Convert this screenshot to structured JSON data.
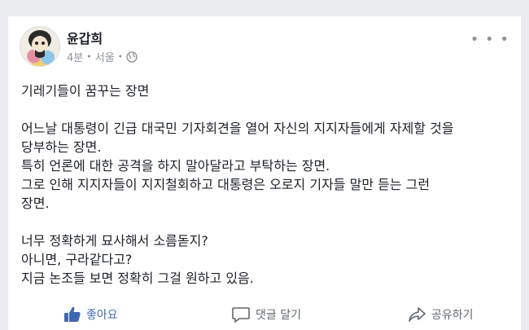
{
  "post": {
    "author": "윤갑희",
    "time": "4분",
    "location": "서울",
    "separator": "•",
    "title": "기레기들이 꿈꾸는 장면",
    "paragraph1": [
      "어느날 대통령이 긴급 대국민 기자회견을 열어 자신의 지지자들에게 자제할 것을",
      "당부하는 장면.",
      "특히 언론에 대한 공격을 하지 말아달라고 부탁하는 장면.",
      "그로 인해 지지자들이 지지철회하고 대통령은 오로지 기자들 말만 듣는 그런",
      "장면."
    ],
    "paragraph2": [
      "너무 정확하게 묘사해서 소름돋지?",
      "아니면, 구라같다고?",
      "지금 논조들 보면 정확히 그걸 원하고 있음."
    ]
  },
  "actions": {
    "like": "좋아요",
    "comment": "댓글 달기",
    "share": "공유하기"
  },
  "colors": {
    "like": "#4267b2",
    "text": "#1d2129",
    "muted": "#90949c"
  },
  "icons": {
    "more": "more-dots-icon",
    "globe": "globe-icon",
    "like": "thumbs-up-icon",
    "comment": "comment-bubble-icon",
    "share": "share-arrow-icon"
  }
}
